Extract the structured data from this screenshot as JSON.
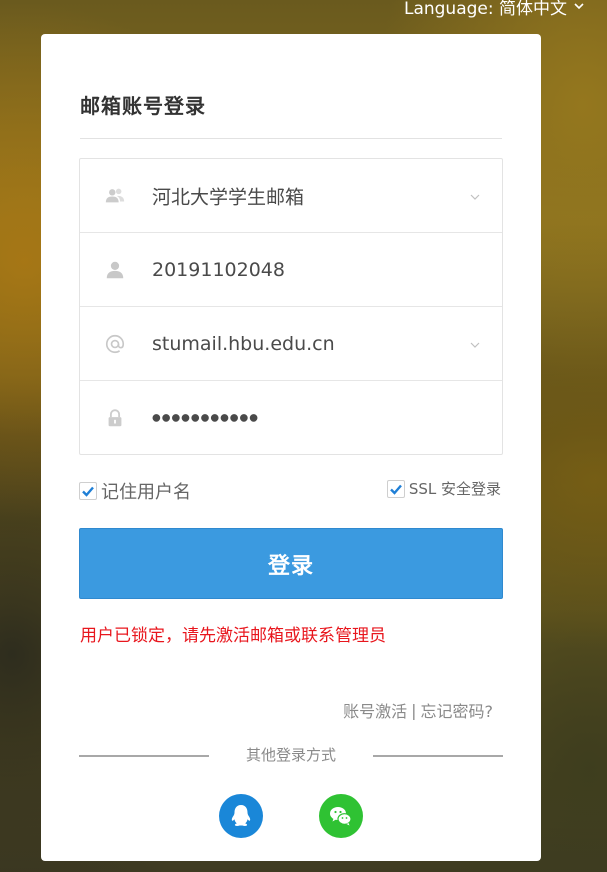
{
  "header": {
    "language_label": "Language: 简体中文"
  },
  "login": {
    "title": "邮箱账号登录",
    "org_select": {
      "value": "河北大学学生邮箱",
      "icon": "users-icon"
    },
    "username": {
      "value": "20191102048",
      "icon": "user-icon"
    },
    "domain_select": {
      "value": "stumail.hbu.edu.cn",
      "icon": "at-icon"
    },
    "password": {
      "value": "●●●●●●●●●●●",
      "icon": "lock-icon"
    },
    "remember_label": "记住用户名",
    "ssl_label": "SSL 安全登录",
    "remember_checked": true,
    "ssl_checked": true,
    "submit_label": "登录",
    "error_message": "用户已锁定，请先激活邮箱或联系管理员",
    "link_activate": "账号激活",
    "link_separator": "|",
    "link_forgot": "忘记密码?",
    "other_methods_label": "其他登录方式"
  },
  "social": {
    "qq": {
      "icon": "qq-icon",
      "color": "#1a87d8"
    },
    "wechat": {
      "icon": "wechat-icon",
      "color": "#2fc233"
    }
  },
  "colors": {
    "primary": "#3b9ae0",
    "error": "#e8161d",
    "check": "#1f7fd6"
  }
}
